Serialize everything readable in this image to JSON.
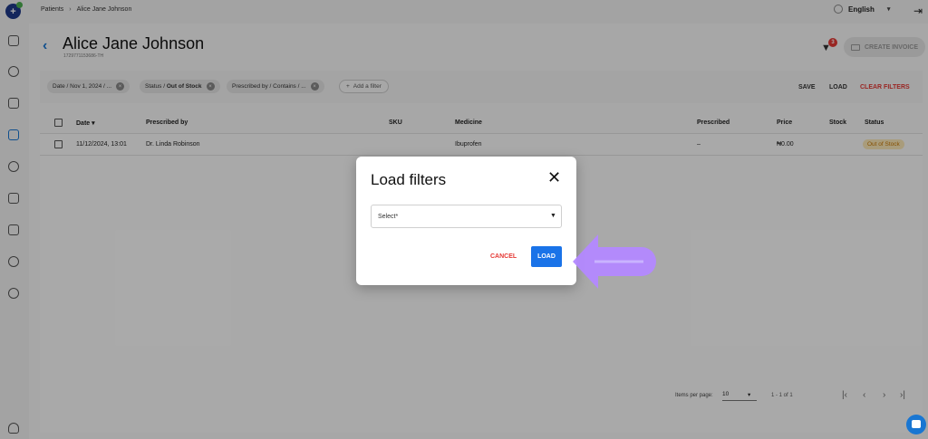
{
  "topbar": {
    "breadcrumb": [
      "Patients",
      "Alice Jane Johnson"
    ],
    "breadcrumb_sep": "›",
    "language": "English"
  },
  "page": {
    "title": "Alice Jane Johnson",
    "patient_id": "1729771153686-TH",
    "filter_count": "3",
    "create_invoice_label": "CREATE INVOICE"
  },
  "filters": {
    "chips": [
      {
        "prefix": "Date / Nov 1, 2024 / ...",
        "bold": ""
      },
      {
        "prefix": "Status / ",
        "bold": "Out of Stock"
      },
      {
        "prefix": "Prescribed by / Contains / ...",
        "bold": ""
      }
    ],
    "add_filter_label": "Add a filter",
    "save_label": "SAVE",
    "load_label": "LOAD",
    "clear_label": "CLEAR FILTERS"
  },
  "table": {
    "headers": [
      "Date",
      "Prescribed by",
      "SKU",
      "Medicine",
      "Prescribed",
      "Price",
      "Stock",
      "Status"
    ],
    "sort_indicator": "▾",
    "rows": [
      {
        "date": "11/12/2024, 13:01",
        "prescribed_by": "Dr. Linda Robinson",
        "sku": "",
        "medicine": "Ibuprofen",
        "prescribed": "–",
        "price": "₦0.00",
        "stock": "",
        "status": "Out of Stock"
      }
    ]
  },
  "pagination": {
    "items_per_page_label": "Items per page:",
    "items_per_page_value": "10",
    "range": "1 - 1 of 1"
  },
  "modal": {
    "title": "Load filters",
    "select_placeholder": "Select*",
    "cancel_label": "CANCEL",
    "load_label": "LOAD"
  },
  "colors": {
    "accent": "#1a73e8",
    "danger": "#e53935",
    "arrow": "#b388ff",
    "status_bg": "#fde9b8",
    "status_text": "#c77700"
  }
}
